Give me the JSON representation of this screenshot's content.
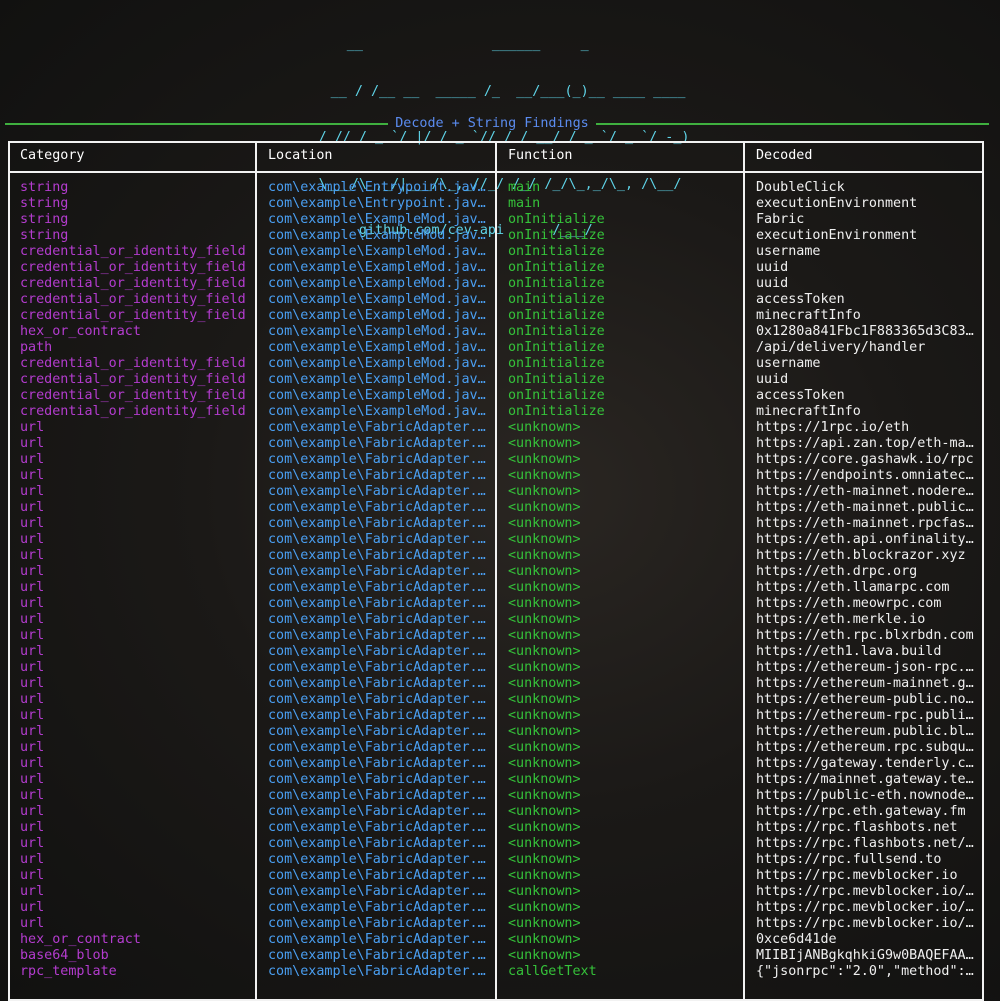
{
  "banner": {
    "lines": [
      "    __                ______     _            ",
      "  __ / /__ __  _____ /_  __/___(_)__ ____ ____",
      " / // / _ `/ |/ / _ `// / / __/ / _ `/ _ `/ -_)",
      " \\___/\\_,_/|___/\\_,_//_/ /_/ /_/\\_,_/\\_, /\\__/ ",
      "     github.com/cev-api      /___/           "
    ]
  },
  "section_title": "Decode + String Findings",
  "table": {
    "headers": [
      "Category",
      "Location",
      "Function",
      "Decoded"
    ],
    "rows": [
      [
        "string",
        "com\\example\\Entrypoint.jav…",
        "main",
        "DoubleClick"
      ],
      [
        "string",
        "com\\example\\Entrypoint.jav…",
        "main",
        "executionEnvironment"
      ],
      [
        "string",
        "com\\example\\ExampleMod.jav…",
        "onInitialize",
        "Fabric"
      ],
      [
        "string",
        "com\\example\\ExampleMod.jav…",
        "onInitialize",
        "executionEnvironment"
      ],
      [
        "credential_or_identity_field",
        "com\\example\\ExampleMod.jav…",
        "onInitialize",
        "username"
      ],
      [
        "credential_or_identity_field",
        "com\\example\\ExampleMod.jav…",
        "onInitialize",
        "uuid"
      ],
      [
        "credential_or_identity_field",
        "com\\example\\ExampleMod.jav…",
        "onInitialize",
        "uuid"
      ],
      [
        "credential_or_identity_field",
        "com\\example\\ExampleMod.jav…",
        "onInitialize",
        "accessToken"
      ],
      [
        "credential_or_identity_field",
        "com\\example\\ExampleMod.jav…",
        "onInitialize",
        "minecraftInfo"
      ],
      [
        "hex_or_contract",
        "com\\example\\ExampleMod.jav…",
        "onInitialize",
        "0x1280a841Fbc1F883365d3C83…"
      ],
      [
        "path",
        "com\\example\\ExampleMod.jav…",
        "onInitialize",
        "/api/delivery/handler"
      ],
      [
        "credential_or_identity_field",
        "com\\example\\ExampleMod.jav…",
        "onInitialize",
        "username"
      ],
      [
        "credential_or_identity_field",
        "com\\example\\ExampleMod.jav…",
        "onInitialize",
        "uuid"
      ],
      [
        "credential_or_identity_field",
        "com\\example\\ExampleMod.jav…",
        "onInitialize",
        "accessToken"
      ],
      [
        "credential_or_identity_field",
        "com\\example\\ExampleMod.jav…",
        "onInitialize",
        "minecraftInfo"
      ],
      [
        "url",
        "com\\example\\FabricAdapter.…",
        "<unknown>",
        "https://1rpc.io/eth"
      ],
      [
        "url",
        "com\\example\\FabricAdapter.…",
        "<unknown>",
        "https://api.zan.top/eth-ma…"
      ],
      [
        "url",
        "com\\example\\FabricAdapter.…",
        "<unknown>",
        "https://core.gashawk.io/rpc"
      ],
      [
        "url",
        "com\\example\\FabricAdapter.…",
        "<unknown>",
        "https://endpoints.omniatec…"
      ],
      [
        "url",
        "com\\example\\FabricAdapter.…",
        "<unknown>",
        "https://eth-mainnet.nodere…"
      ],
      [
        "url",
        "com\\example\\FabricAdapter.…",
        "<unknown>",
        "https://eth-mainnet.public…"
      ],
      [
        "url",
        "com\\example\\FabricAdapter.…",
        "<unknown>",
        "https://eth-mainnet.rpcfas…"
      ],
      [
        "url",
        "com\\example\\FabricAdapter.…",
        "<unknown>",
        "https://eth.api.onfinality…"
      ],
      [
        "url",
        "com\\example\\FabricAdapter.…",
        "<unknown>",
        "https://eth.blockrazor.xyz"
      ],
      [
        "url",
        "com\\example\\FabricAdapter.…",
        "<unknown>",
        "https://eth.drpc.org"
      ],
      [
        "url",
        "com\\example\\FabricAdapter.…",
        "<unknown>",
        "https://eth.llamarpc.com"
      ],
      [
        "url",
        "com\\example\\FabricAdapter.…",
        "<unknown>",
        "https://eth.meowrpc.com"
      ],
      [
        "url",
        "com\\example\\FabricAdapter.…",
        "<unknown>",
        "https://eth.merkle.io"
      ],
      [
        "url",
        "com\\example\\FabricAdapter.…",
        "<unknown>",
        "https://eth.rpc.blxrbdn.com"
      ],
      [
        "url",
        "com\\example\\FabricAdapter.…",
        "<unknown>",
        "https://eth1.lava.build"
      ],
      [
        "url",
        "com\\example\\FabricAdapter.…",
        "<unknown>",
        "https://ethereum-json-rpc.…"
      ],
      [
        "url",
        "com\\example\\FabricAdapter.…",
        "<unknown>",
        "https://ethereum-mainnet.g…"
      ],
      [
        "url",
        "com\\example\\FabricAdapter.…",
        "<unknown>",
        "https://ethereum-public.no…"
      ],
      [
        "url",
        "com\\example\\FabricAdapter.…",
        "<unknown>",
        "https://ethereum-rpc.publi…"
      ],
      [
        "url",
        "com\\example\\FabricAdapter.…",
        "<unknown>",
        "https://ethereum.public.bl…"
      ],
      [
        "url",
        "com\\example\\FabricAdapter.…",
        "<unknown>",
        "https://ethereum.rpc.subqu…"
      ],
      [
        "url",
        "com\\example\\FabricAdapter.…",
        "<unknown>",
        "https://gateway.tenderly.c…"
      ],
      [
        "url",
        "com\\example\\FabricAdapter.…",
        "<unknown>",
        "https://mainnet.gateway.te…"
      ],
      [
        "url",
        "com\\example\\FabricAdapter.…",
        "<unknown>",
        "https://public-eth.nownode…"
      ],
      [
        "url",
        "com\\example\\FabricAdapter.…",
        "<unknown>",
        "https://rpc.eth.gateway.fm"
      ],
      [
        "url",
        "com\\example\\FabricAdapter.…",
        "<unknown>",
        "https://rpc.flashbots.net"
      ],
      [
        "url",
        "com\\example\\FabricAdapter.…",
        "<unknown>",
        "https://rpc.flashbots.net/…"
      ],
      [
        "url",
        "com\\example\\FabricAdapter.…",
        "<unknown>",
        "https://rpc.fullsend.to"
      ],
      [
        "url",
        "com\\example\\FabricAdapter.…",
        "<unknown>",
        "https://rpc.mevblocker.io"
      ],
      [
        "url",
        "com\\example\\FabricAdapter.…",
        "<unknown>",
        "https://rpc.mevblocker.io/…"
      ],
      [
        "url",
        "com\\example\\FabricAdapter.…",
        "<unknown>",
        "https://rpc.mevblocker.io/…"
      ],
      [
        "url",
        "com\\example\\FabricAdapter.…",
        "<unknown>",
        "https://rpc.mevblocker.io/…"
      ],
      [
        "hex_or_contract",
        "com\\example\\FabricAdapter.…",
        "<unknown>",
        "0xce6d41de"
      ],
      [
        "base64_blob",
        "com\\example\\FabricAdapter.…",
        "<unknown>",
        "MIIBIjANBgkqhkiG9w0BAQEFAA…"
      ],
      [
        "rpc_template",
        "com\\example\\FabricAdapter.…",
        "callGetText",
        "{\"jsonrpc\":\"2.0\",\"method\":…"
      ]
    ]
  },
  "colors": {
    "banner": "#5fd4e8",
    "rule": "#3fb03f",
    "section_title": "#5b8cf0",
    "category": "#b43ccf",
    "location": "#4a9ff2",
    "function": "#35c23a",
    "decoded": "#f0f0f0",
    "border": "#f2f2f2"
  }
}
